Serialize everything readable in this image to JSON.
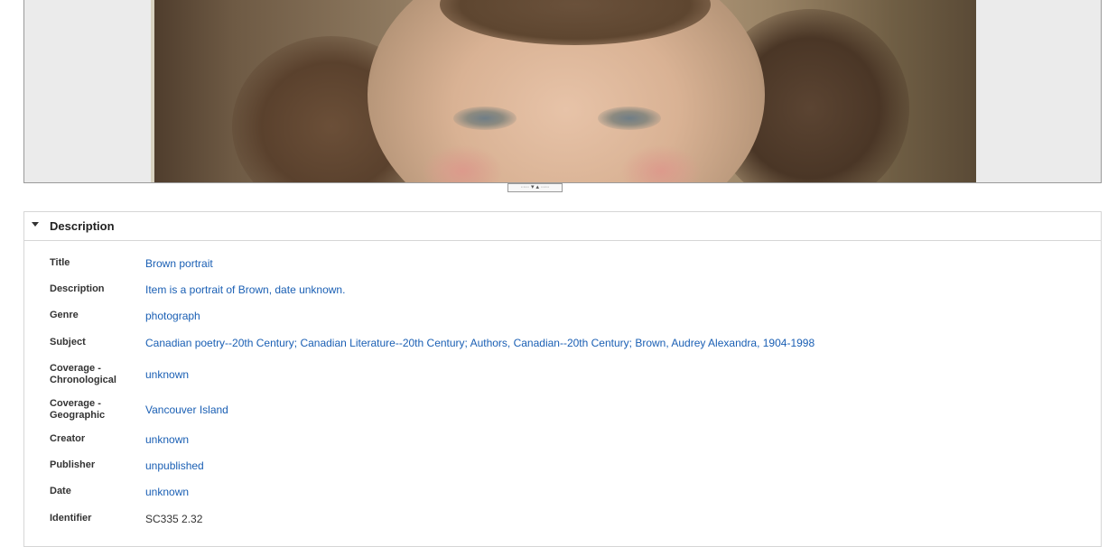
{
  "viewer": {
    "splitter_glyphs": "···· ▾ ▴ ····"
  },
  "panel": {
    "title": "Description"
  },
  "fields": {
    "title": {
      "label": "Title",
      "value": "Brown portrait"
    },
    "description": {
      "label": "Description",
      "value": "Item is a portrait of Brown, date unknown."
    },
    "genre": {
      "label": "Genre",
      "value": "photograph"
    },
    "subject": {
      "label": "Subject",
      "values": [
        "Canadian poetry--20th Century",
        "Canadian Literature--20th Century",
        "Authors, Canadian--20th Century",
        "Brown, Audrey Alexandra, 1904-1998"
      ],
      "separator": ";"
    },
    "coverage_chrono": {
      "label": "Coverage - Chronological",
      "value": "unknown"
    },
    "coverage_geo": {
      "label": "Coverage - Geographic",
      "value": "Vancouver Island"
    },
    "creator": {
      "label": "Creator",
      "value": "unknown"
    },
    "publisher": {
      "label": "Publisher",
      "value": "unpublished"
    },
    "date": {
      "label": "Date",
      "value": "unknown"
    },
    "identifier": {
      "label": "Identifier",
      "value": "SC335 2.32"
    }
  },
  "colors": {
    "link": "#1a5fb4",
    "border": "#d6d6d6",
    "viewer_bg": "#ebebeb"
  }
}
